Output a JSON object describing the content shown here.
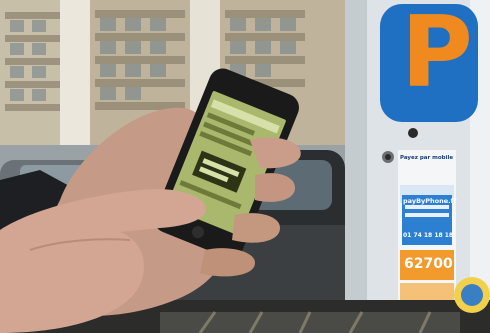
{
  "photo": {
    "parking_sign_letter": "P",
    "meter": {
      "heading": "Payez par mobile",
      "website": "payByPhone.fr",
      "phone": "01 74 18 18 18",
      "zone_number": "62700"
    }
  },
  "colors": {
    "sky": "#b5c6cf",
    "building": "#b9ac92",
    "meter_body": "#e7ecef",
    "parking_sign": "#1f6fc2",
    "parking_letter": "#f08a1e",
    "skin": "#c89c88",
    "phone": "#1a1a1a",
    "phone_screen": "#a9b86c",
    "sticker_blue": "#2d7fd1",
    "sticker_orange": "#f39a2c"
  }
}
